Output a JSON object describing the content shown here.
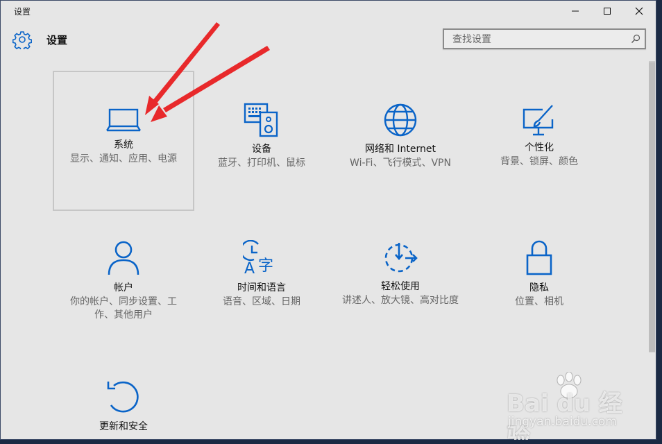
{
  "window": {
    "title": "设置",
    "minimize_icon": "minimize-icon",
    "maximize_icon": "maximize-icon",
    "close_icon": "close-icon"
  },
  "header": {
    "title": "设置",
    "icon": "gear-icon"
  },
  "search": {
    "placeholder": "查找设置",
    "value": "",
    "icon": "search-icon"
  },
  "accent_color": "#0a64c8",
  "arrow_color": "#e8292b",
  "tiles": [
    {
      "name": "系统",
      "desc": "显示、通知、应用、电源",
      "icon": "laptop-icon",
      "selected": true
    },
    {
      "name": "设备",
      "desc": "蓝牙、打印机、鼠标",
      "icon": "devices-icon"
    },
    {
      "name": "网络和 Internet",
      "desc": "Wi-Fi、飞行模式、VPN",
      "icon": "globe-icon"
    },
    {
      "name": "个性化",
      "desc": "背景、锁屏、颜色",
      "icon": "paintbrush-icon"
    },
    {
      "name": "帐户",
      "desc": "你的帐户、同步设置、工作、其他用户",
      "icon": "person-icon"
    },
    {
      "name": "时间和语言",
      "desc": "语音、区域、日期",
      "icon": "time-language-icon"
    },
    {
      "name": "轻松使用",
      "desc": "讲述人、放大镜、高对比度",
      "icon": "ease-of-access-icon"
    },
    {
      "name": "隐私",
      "desc": "位置、相机",
      "icon": "lock-icon"
    },
    {
      "name": "更新和安全",
      "desc": "",
      "icon": "update-icon"
    }
  ],
  "watermark": {
    "brand": "Bai du 经验",
    "url": "jingyan.baidu.com"
  }
}
